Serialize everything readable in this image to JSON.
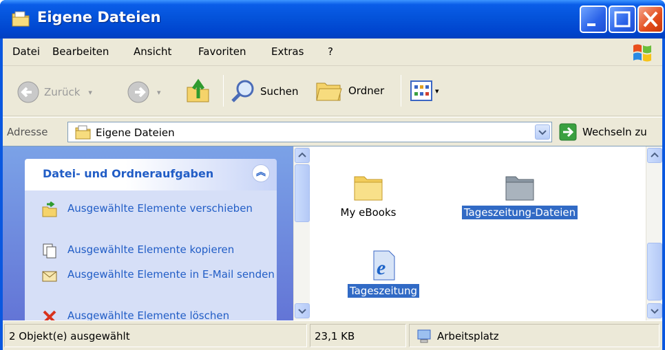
{
  "window": {
    "title": "Eigene Dateien"
  },
  "menu": [
    "Datei",
    "Bearbeiten",
    "Ansicht",
    "Favoriten",
    "Extras",
    "?"
  ],
  "toolbar": {
    "back_label": "Zurück",
    "search_label": "Suchen",
    "folders_label": "Ordner"
  },
  "address": {
    "label": "Adresse",
    "value": "Eigene Dateien",
    "go_label": "Wechseln zu"
  },
  "tasks": {
    "heading": "Datei- und Ordneraufgaben",
    "items": [
      {
        "label": "Ausgewählte Elemente verschieben",
        "icon": "move-icon"
      },
      {
        "label": "Ausgewählte Elemente kopieren",
        "icon": "copy-icon"
      },
      {
        "label": "Ausgewählte Elemente in E-Mail senden",
        "icon": "email-icon"
      },
      {
        "label": "Ausgewählte Elemente löschen",
        "icon": "delete-icon"
      }
    ]
  },
  "files": [
    {
      "name": "My eBooks",
      "icon": "folder-icon",
      "selected": false
    },
    {
      "name": "Tageszeitung-Dateien",
      "icon": "folder-icon",
      "selected": true
    },
    {
      "name": "Tageszeitung",
      "icon": "ie-document-icon",
      "selected": true
    }
  ],
  "status": {
    "selection": "2 Objekt(e) ausgewählt",
    "size": "23,1 KB",
    "location": "Arbeitsplatz"
  },
  "colors": {
    "titlebar": "#0453da",
    "selection": "#316ac5",
    "task_link": "#215dc6",
    "pane": "#6f8fdf"
  }
}
